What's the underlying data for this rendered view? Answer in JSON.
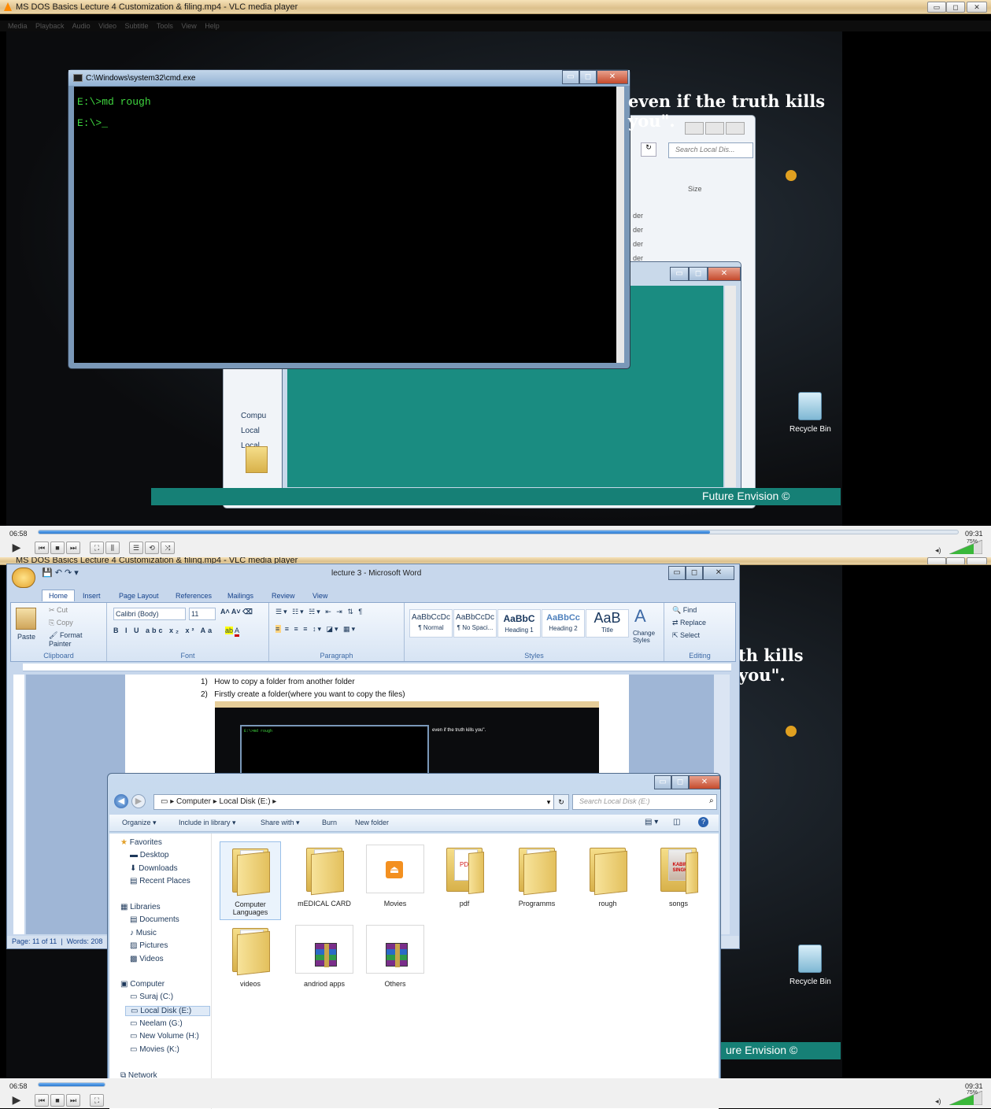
{
  "top": {
    "vlc_title": "MS DOS Basics Lecture 4 Customization & filing.mp4 - VLC media player",
    "menu": [
      "Media",
      "Playback",
      "Audio",
      "Video",
      "Subtitle",
      "Tools",
      "View",
      "Help"
    ],
    "cmd_title": "C:\\Windows\\system32\\cmd.exe",
    "cmd_line1": "E:\\>md rough",
    "cmd_line2": "E:\\>_",
    "quote": "even if the truth kills you\".",
    "search_placeholder": "Search Local Dis...",
    "size_header": "Size",
    "partial_items": [
      "der",
      "der",
      "der",
      "der"
    ],
    "nav_partial": [
      "Compu",
      "Local",
      "Local"
    ],
    "recycle_bin": "Recycle Bin",
    "footer_text": "Future Envision ©",
    "time_elapsed": "06:58",
    "time_total": "09:31",
    "volume": "75%",
    "progress_fraction": 0.73
  },
  "bottom": {
    "vlc_title_partial": "MS DOS Basics Lecture 4 Customization & filing.mp4 - VLC media player",
    "word": {
      "title": "lecture 3 - Microsoft Word",
      "tabs": [
        "Home",
        "Insert",
        "Page Layout",
        "References",
        "Mailings",
        "Review",
        "View"
      ],
      "clipboard": {
        "paste": "Paste",
        "cut": "Cut",
        "copy": "Copy",
        "format_painter": "Format Painter",
        "label": "Clipboard"
      },
      "font": {
        "name": "Calibri (Body)",
        "size": "11",
        "label": "Font"
      },
      "paragraph_label": "Paragraph",
      "styles": [
        {
          "sample": "AaBbCcDc",
          "name": "¶ Normal"
        },
        {
          "sample": "AaBbCcDc",
          "name": "¶ No Spaci..."
        },
        {
          "sample": "AaBbC",
          "name": "Heading 1"
        },
        {
          "sample": "AaBbCc",
          "name": "Heading 2"
        },
        {
          "sample": "AaB",
          "name": "Title"
        }
      ],
      "change_styles": "Change Styles",
      "styles_label": "Styles",
      "editing": {
        "find": "Find",
        "replace": "Replace",
        "select": "Select",
        "label": "Editing"
      },
      "list_items": [
        "How to copy a folder from another folder",
        "Firstly create a folder(where you want to copy the files)"
      ],
      "status_page": "Page: 11 of 11",
      "status_words": "Words: 208"
    },
    "explorer": {
      "breadcrumb": [
        "Computer",
        "Local Disk (E:)"
      ],
      "search_placeholder": "Search Local Disk (E:)",
      "toolbar": [
        "Organize",
        "Include in library",
        "Share with",
        "Burn",
        "New folder"
      ],
      "nav": {
        "favorites": "Favorites",
        "fav_items": [
          "Desktop",
          "Downloads",
          "Recent Places"
        ],
        "libraries": "Libraries",
        "lib_items": [
          "Documents",
          "Music",
          "Pictures",
          "Videos"
        ],
        "computer": "Computer",
        "drives": [
          "Suraj (C:)",
          "Local Disk (E:)",
          "Neelam (G:)",
          "New Volume (H:)",
          "Movies (K:)"
        ],
        "network": "Network"
      },
      "items": [
        "Computer Languages",
        "mEDICAL CARD",
        "Movies",
        "pdf",
        "Programms",
        "rough",
        "songs",
        "videos",
        "andriod apps",
        "Others"
      ],
      "pdf_label": "PDF",
      "songs_cover": "KABIR SINGH"
    },
    "quote": "th kills you\".",
    "recycle_bin": "Recycle Bin",
    "footer_text": "ure Envision ©",
    "time_elapsed": "06:58",
    "time_total": "09:31",
    "volume": "75%"
  },
  "colors": {
    "teal": "#1a8c81",
    "vlc_title": "#e6cd99",
    "word_blue": "#c7d7ec",
    "progress": "#2978d0"
  }
}
